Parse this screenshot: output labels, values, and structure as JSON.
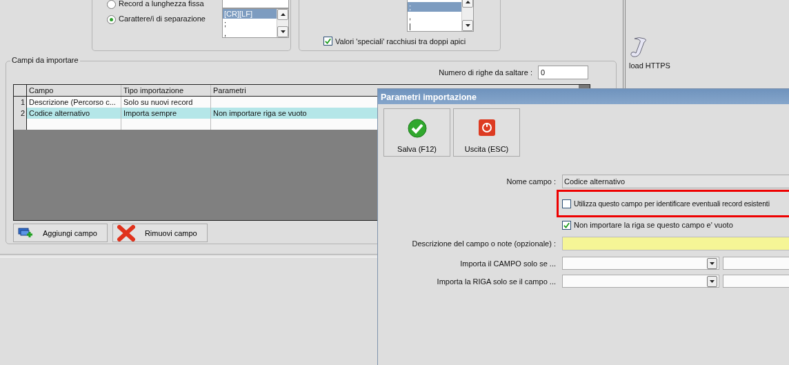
{
  "record_mode": {
    "options": [
      {
        "label": "Record a lunghezza fissa",
        "selected": false,
        "kind": "input"
      },
      {
        "label": "Carattere/i di separazione",
        "selected": true,
        "kind": "list"
      }
    ],
    "separator_list": [
      {
        "label": "[CR][LF]",
        "selected": true
      },
      {
        "label": ";",
        "selected": false
      },
      {
        "label": ",",
        "selected": false
      }
    ]
  },
  "quote_options": {
    "list": [
      {
        "label": ";",
        "selected": true
      },
      {
        "label": ",",
        "selected": false
      },
      {
        "label": "|",
        "selected": false
      }
    ],
    "checkbox": {
      "label": "Valori 'speciali' racchiusi tra doppi apici",
      "checked": true
    }
  },
  "fields_group": {
    "title": "Campi da importare",
    "skip_rows_label": "Numero di righe da saltare  :",
    "skip_rows_value": "0",
    "table": {
      "columns": [
        "Campo",
        "Tipo importazione",
        "Parametri"
      ],
      "rows": [
        {
          "number": "1",
          "cells": [
            "Descrizione (Percorso c...",
            "Solo su nuovi record",
            ""
          ],
          "selected": false
        },
        {
          "number": "2",
          "cells": [
            "Codice alternativo",
            "Importa sempre",
            "Non importare riga se vuoto"
          ],
          "selected": true
        }
      ]
    },
    "buttons": [
      {
        "label": "Aggiungi campo",
        "kind": "add"
      },
      {
        "label": "Rimuovi campo",
        "kind": "remove"
      }
    ]
  },
  "side_panel": {
    "item": "load HTTPS"
  },
  "dialog": {
    "title": "Parametri importazione",
    "toolbar": [
      {
        "label": "Salva (F12)",
        "kind": "save"
      },
      {
        "label": "Uscita (ESC)",
        "kind": "exit"
      }
    ],
    "field_name": {
      "label": "Nome campo :",
      "value": "Codice alternativo"
    },
    "options": [
      {
        "label": "Utilizza questo campo per identificare eventuali record esistenti",
        "checked": false,
        "highlighted": true
      },
      {
        "label": "Non importare la riga se questo campo e' vuoto",
        "checked": true,
        "highlighted": false
      }
    ],
    "description": {
      "label": "Descrizione del campo o note (opzionale) :"
    },
    "conditions": [
      {
        "label": "Importa il CAMPO solo se ..."
      },
      {
        "label": "Importa la RIGA solo se il campo ..."
      }
    ]
  }
}
